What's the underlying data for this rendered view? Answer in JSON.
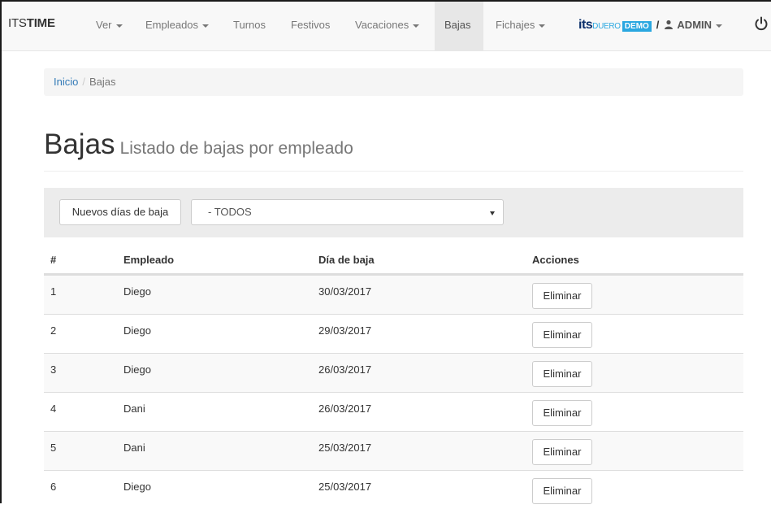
{
  "navbar": {
    "brand_light": "ITS",
    "brand_bold": "TIME",
    "items": [
      {
        "label": "Ver",
        "dropdown": true
      },
      {
        "label": "Empleados",
        "dropdown": true
      },
      {
        "label": "Turnos",
        "dropdown": false
      },
      {
        "label": "Festivos",
        "dropdown": false
      },
      {
        "label": "Vacaciones",
        "dropdown": true
      },
      {
        "label": "Bajas",
        "dropdown": false,
        "active": true
      },
      {
        "label": "Fichajes",
        "dropdown": true
      }
    ],
    "org": {
      "logo_its": "its",
      "logo_duero": "DUERO",
      "badge": "DEMO",
      "separator": "/",
      "user": "ADMIN"
    },
    "icons": {
      "user": "user-icon",
      "power": "power-icon"
    },
    "colors": {
      "brand_navy": "#0b2f6a",
      "brand_cyan": "#2aa7e0"
    }
  },
  "breadcrumb": {
    "home": "Inicio",
    "separator": "/",
    "current": "Bajas"
  },
  "header": {
    "title": "Bajas",
    "subtitle": "Listado de bajas por empleado"
  },
  "toolbar": {
    "new_button": "Nuevos días de baja",
    "filter_value": "- TODOS"
  },
  "table": {
    "columns": [
      "#",
      "Empleado",
      "Día de baja",
      "Acciones"
    ],
    "rows": [
      {
        "num": "1",
        "employee": "Diego",
        "date": "30/03/2017",
        "action": "Eliminar"
      },
      {
        "num": "2",
        "employee": "Diego",
        "date": "29/03/2017",
        "action": "Eliminar"
      },
      {
        "num": "3",
        "employee": "Diego",
        "date": "26/03/2017",
        "action": "Eliminar"
      },
      {
        "num": "4",
        "employee": "Dani",
        "date": "26/03/2017",
        "action": "Eliminar"
      },
      {
        "num": "5",
        "employee": "Dani",
        "date": "25/03/2017",
        "action": "Eliminar"
      },
      {
        "num": "6",
        "employee": "Diego",
        "date": "25/03/2017",
        "action": "Eliminar"
      }
    ]
  }
}
